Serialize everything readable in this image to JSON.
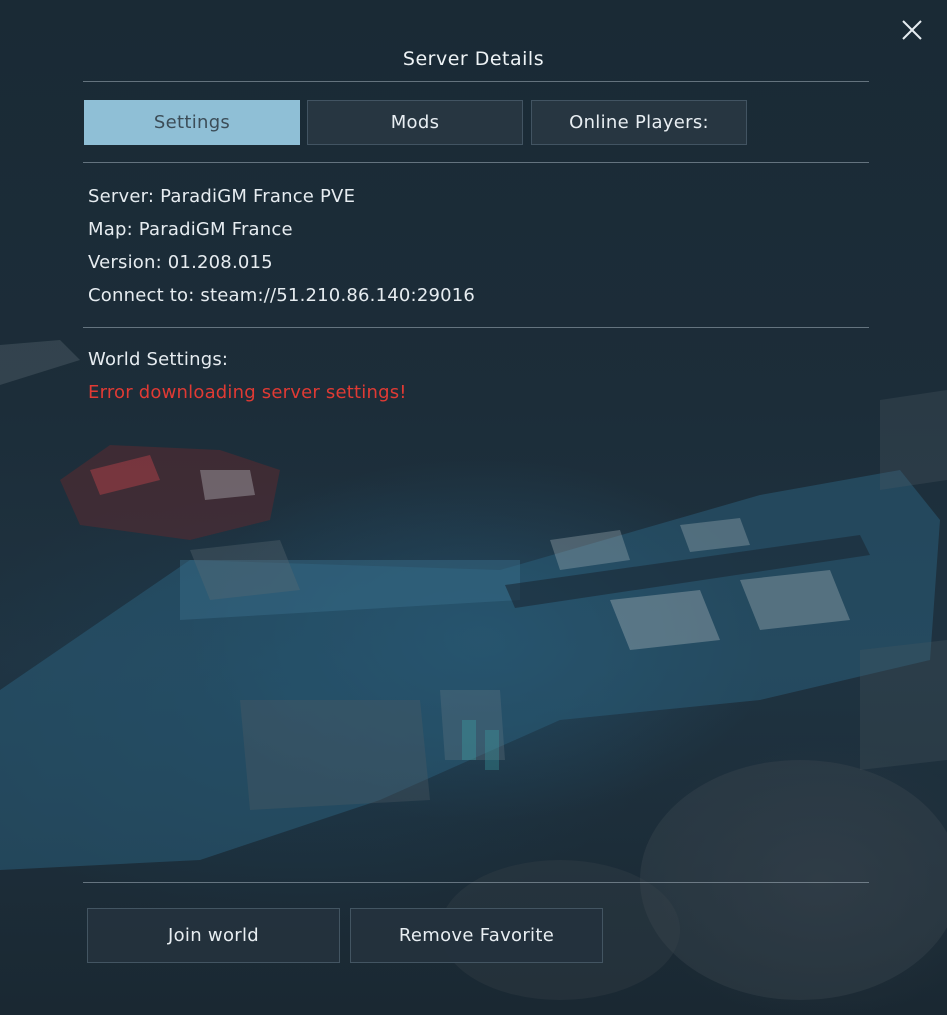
{
  "dialog": {
    "title": "Server Details",
    "close_icon": "close-icon"
  },
  "tabs": [
    {
      "label": "Settings",
      "active": true
    },
    {
      "label": "Mods",
      "active": false
    },
    {
      "label": "Online Players:",
      "active": false
    }
  ],
  "server_info": {
    "server": "Server: ParadiGM France PVE",
    "map": "Map: ParadiGM France",
    "version": "Version: 01.208.015",
    "connect": "Connect to: steam://51.210.86.140:29016"
  },
  "world_settings": {
    "heading": "World Settings:",
    "error": "Error downloading server settings!"
  },
  "buttons": {
    "join": "Join world",
    "remove_favorite": "Remove Favorite"
  },
  "colors": {
    "active_tab": "#8fbfd6",
    "error": "#e03a34"
  }
}
